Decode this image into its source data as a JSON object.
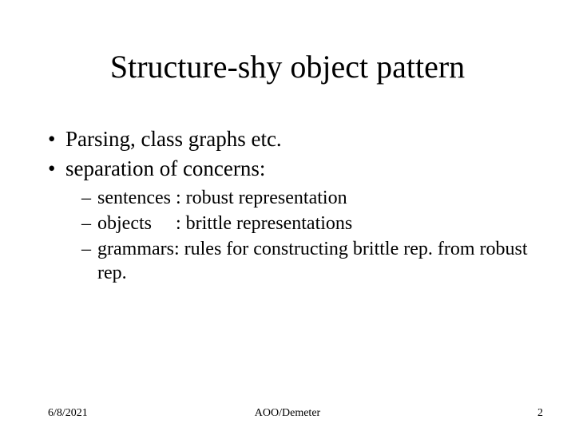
{
  "title": "Structure-shy object pattern",
  "bullets": {
    "l1": [
      "Parsing, class graphs etc.",
      "separation of concerns:"
    ],
    "l2": [
      "sentences : robust representation",
      "objects     : brittle representations",
      "grammars: rules for constructing brittle rep. from robust rep."
    ]
  },
  "footer": {
    "date": "6/8/2021",
    "center": "AOO/Demeter",
    "page": "2"
  },
  "glyphs": {
    "bullet": "•",
    "dash": "–"
  }
}
